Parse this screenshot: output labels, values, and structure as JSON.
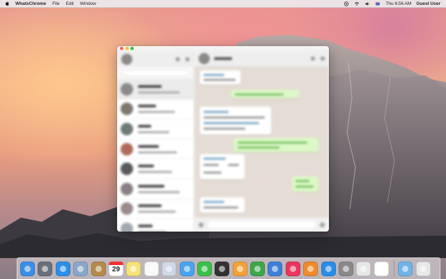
{
  "menubar": {
    "apple_icon": "apple-icon",
    "app_name": "WhatsChrome",
    "items": [
      "File",
      "Edit",
      "Window"
    ],
    "status_icons": [
      "chrome-extension-icon",
      "wifi-icon",
      "volume-icon",
      "flag-icon"
    ],
    "clock": "Thu 6:56 AM",
    "user": "Guest User"
  },
  "window": {
    "title_buttons": [
      "close",
      "minimize",
      "maximize"
    ],
    "sidebar_chat_count": 8,
    "message_count": 8
  },
  "dock": {
    "apps": [
      {
        "name": "Finder",
        "icon": "finder-icon",
        "color": "#3a8ee6"
      },
      {
        "name": "Launchpad",
        "icon": "rocket-icon",
        "color": "#6a6f7a"
      },
      {
        "name": "Safari",
        "icon": "compass-icon",
        "color": "#2d8fe6"
      },
      {
        "name": "Mail",
        "icon": "stamp-icon",
        "color": "#8aa6c8"
      },
      {
        "name": "Contacts",
        "icon": "contacts-icon",
        "color": "#b38a4a"
      },
      {
        "name": "Calendar",
        "icon": "calendar-icon",
        "color": "#ffffff"
      },
      {
        "name": "Notes",
        "icon": "notes-icon",
        "color": "#f6e27a"
      },
      {
        "name": "Reminders",
        "icon": "reminders-icon",
        "color": "#f8f8f8"
      },
      {
        "name": "Preview",
        "icon": "photos-preview-icon",
        "color": "#cfd8e6"
      },
      {
        "name": "Messages",
        "icon": "speech-bubble-icon",
        "color": "#4aa3f0"
      },
      {
        "name": "FaceTime",
        "icon": "video-camera-icon",
        "color": "#3bbf4a"
      },
      {
        "name": "Photo Booth",
        "icon": "photo-booth-icon",
        "color": "#333333"
      },
      {
        "name": "Pages",
        "icon": "pages-icon",
        "color": "#f2a23a"
      },
      {
        "name": "Numbers",
        "icon": "bar-chart-icon",
        "color": "#3ea64a"
      },
      {
        "name": "Keynote",
        "icon": "keynote-icon",
        "color": "#3f7fd8"
      },
      {
        "name": "iTunes",
        "icon": "music-note-icon",
        "color": "#e8365c"
      },
      {
        "name": "iBooks",
        "icon": "book-icon",
        "color": "#f08a2a"
      },
      {
        "name": "App Store",
        "icon": "app-store-icon",
        "color": "#2a8ce6"
      },
      {
        "name": "System Preferences",
        "icon": "gear-icon",
        "color": "#8a8a8a"
      },
      {
        "name": "Chrome",
        "icon": "chrome-icon",
        "color": "#e7e7e7"
      },
      {
        "name": "WhatsChrome",
        "icon": "whatsapp-icon",
        "color": "#ffffff"
      }
    ],
    "folders": [
      {
        "name": "Downloads",
        "icon": "downloads-folder-icon",
        "color": "#6fb3e8"
      },
      {
        "name": "Trash",
        "icon": "trash-icon",
        "color": "#e8e8e8"
      }
    ],
    "calendar_day": "29"
  }
}
